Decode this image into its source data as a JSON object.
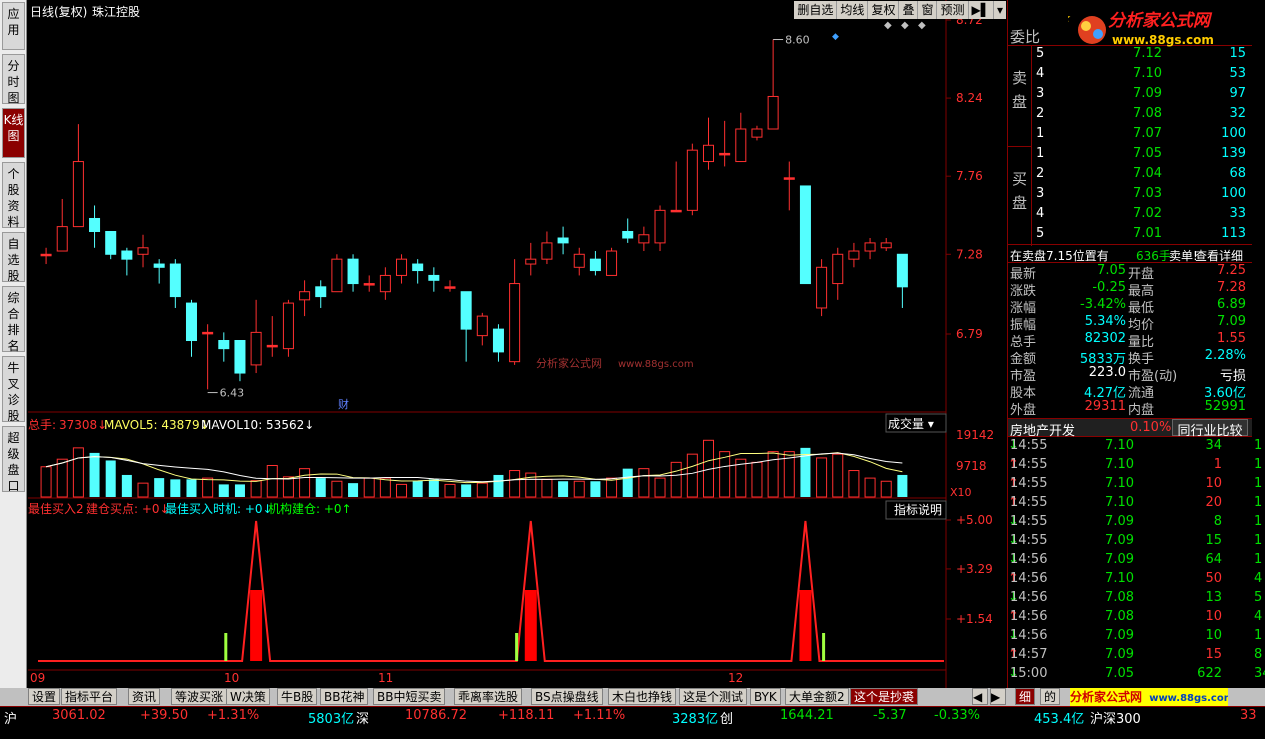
{
  "left_tabs": [
    {
      "label": "应用"
    },
    {
      "label": "分时图"
    },
    {
      "label": "K线图",
      "active": true
    },
    {
      "label": "个股资料"
    },
    {
      "label": "自选股"
    },
    {
      "label": "综合排名"
    },
    {
      "label": "牛叉诊股"
    },
    {
      "label": "超级盘口"
    }
  ],
  "header": {
    "mode": "日线(复权)",
    "stock": "珠江控股",
    "buttons": [
      "删自选",
      "均线",
      "复权",
      "叠",
      "窗",
      "预测"
    ]
  },
  "price_axis": [
    "8.72",
    "8.24",
    "7.76",
    "7.28",
    "6.79"
  ],
  "annotations": {
    "high": "8.60",
    "low": "6.43",
    "cai": "财",
    "watermark1": "分析家公式网",
    "watermark2": "www.88gs.com"
  },
  "volume": {
    "label_total": "总手:",
    "total": "37308",
    "ma5_label": "MAVOL5:",
    "ma5": "43879",
    "ma10_label": "MAVOL10:",
    "ma10": "53562",
    "panel_btn": "成交量",
    "axis": [
      "19142",
      "9718"
    ],
    "unit": "X10"
  },
  "indicator": {
    "l1": "最佳买入2",
    "l2": "建仓买点:",
    "v2": "+0",
    "l3": "最佳买入时机:",
    "v3": "+0",
    "l4": "机构建仓:",
    "v4": "+0",
    "btn": "指标说明",
    "axis": [
      "+5.00",
      "+3.29",
      "+1.54"
    ]
  },
  "dates": [
    "09",
    "10",
    "11",
    "12"
  ],
  "candles": [
    {
      "o": 7.28,
      "c": 7.28,
      "h": 7.32,
      "l": 7.22
    },
    {
      "o": 7.3,
      "c": 7.45,
      "h": 7.62,
      "l": 7.3
    },
    {
      "o": 7.45,
      "c": 7.85,
      "h": 8.08,
      "l": 7.45
    },
    {
      "o": 7.5,
      "c": 7.42,
      "h": 7.58,
      "l": 7.32
    },
    {
      "o": 7.42,
      "c": 7.28,
      "h": 7.42,
      "l": 7.25
    },
    {
      "o": 7.3,
      "c": 7.25,
      "h": 7.32,
      "l": 7.15
    },
    {
      "o": 7.28,
      "c": 7.32,
      "h": 7.4,
      "l": 7.2
    },
    {
      "o": 7.22,
      "c": 7.2,
      "h": 7.25,
      "l": 7.1
    },
    {
      "o": 7.22,
      "c": 7.02,
      "h": 7.25,
      "l": 6.95
    },
    {
      "o": 6.98,
      "c": 6.75,
      "h": 7.0,
      "l": 6.65
    },
    {
      "o": 6.8,
      "c": 6.8,
      "h": 6.85,
      "l": 6.45
    },
    {
      "o": 6.75,
      "c": 6.7,
      "h": 6.8,
      "l": 6.62
    },
    {
      "o": 6.75,
      "c": 6.55,
      "h": 6.75,
      "l": 6.5
    },
    {
      "o": 6.6,
      "c": 6.8,
      "h": 7.0,
      "l": 6.55
    },
    {
      "o": 6.72,
      "c": 6.72,
      "h": 6.9,
      "l": 6.65
    },
    {
      "o": 6.7,
      "c": 6.98,
      "h": 7.0,
      "l": 6.65
    },
    {
      "o": 7.0,
      "c": 7.05,
      "h": 7.12,
      "l": 6.9
    },
    {
      "o": 7.08,
      "c": 7.02,
      "h": 7.12,
      "l": 6.95
    },
    {
      "o": 7.05,
      "c": 7.25,
      "h": 7.28,
      "l": 7.05
    },
    {
      "o": 7.25,
      "c": 7.1,
      "h": 7.28,
      "l": 7.05
    },
    {
      "o": 7.1,
      "c": 7.1,
      "h": 7.15,
      "l": 7.05
    },
    {
      "o": 7.05,
      "c": 7.15,
      "h": 7.2,
      "l": 7.0
    },
    {
      "o": 7.15,
      "c": 7.25,
      "h": 7.28,
      "l": 7.1
    },
    {
      "o": 7.22,
      "c": 7.18,
      "h": 7.25,
      "l": 7.1
    },
    {
      "o": 7.15,
      "c": 7.12,
      "h": 7.2,
      "l": 7.05
    },
    {
      "o": 7.08,
      "c": 7.08,
      "h": 7.12,
      "l": 7.05
    },
    {
      "o": 7.05,
      "c": 6.82,
      "h": 7.05,
      "l": 6.62
    },
    {
      "o": 6.78,
      "c": 6.9,
      "h": 6.92,
      "l": 6.72
    },
    {
      "o": 6.82,
      "c": 6.68,
      "h": 6.85,
      "l": 6.62
    },
    {
      "o": 6.62,
      "c": 7.1,
      "h": 7.25,
      "l": 6.6
    },
    {
      "o": 7.22,
      "c": 7.25,
      "h": 7.35,
      "l": 7.15
    },
    {
      "o": 7.25,
      "c": 7.35,
      "h": 7.42,
      "l": 7.22
    },
    {
      "o": 7.38,
      "c": 7.35,
      "h": 7.45,
      "l": 7.28
    },
    {
      "o": 7.2,
      "c": 7.28,
      "h": 7.32,
      "l": 7.15
    },
    {
      "o": 7.25,
      "c": 7.18,
      "h": 7.3,
      "l": 7.15
    },
    {
      "o": 7.15,
      "c": 7.3,
      "h": 7.32,
      "l": 7.15
    },
    {
      "o": 7.42,
      "c": 7.38,
      "h": 7.5,
      "l": 7.35
    },
    {
      "o": 7.35,
      "c": 7.4,
      "h": 7.45,
      "l": 7.3
    },
    {
      "o": 7.35,
      "c": 7.55,
      "h": 7.58,
      "l": 7.3
    },
    {
      "o": 7.55,
      "c": 7.55,
      "h": 7.85,
      "l": 7.55
    },
    {
      "o": 7.55,
      "c": 7.92,
      "h": 7.96,
      "l": 7.52
    },
    {
      "o": 7.85,
      "c": 7.95,
      "h": 8.12,
      "l": 7.8
    },
    {
      "o": 7.9,
      "c": 7.9,
      "h": 8.1,
      "l": 7.82
    },
    {
      "o": 7.85,
      "c": 8.05,
      "h": 8.15,
      "l": 7.85
    },
    {
      "o": 8.0,
      "c": 8.05,
      "h": 8.07,
      "l": 7.98
    },
    {
      "o": 8.05,
      "c": 8.25,
      "h": 8.6,
      "l": 8.05
    },
    {
      "o": 7.75,
      "c": 7.75,
      "h": 7.85,
      "l": 7.55
    },
    {
      "o": 7.7,
      "c": 7.1,
      "h": 7.7,
      "l": 7.1
    },
    {
      "o": 6.95,
      "c": 7.2,
      "h": 7.25,
      "l": 6.9
    },
    {
      "o": 7.1,
      "c": 7.28,
      "h": 7.32,
      "l": 7.0
    },
    {
      "o": 7.25,
      "c": 7.3,
      "h": 7.35,
      "l": 7.2
    },
    {
      "o": 7.3,
      "c": 7.35,
      "h": 7.38,
      "l": 7.25
    },
    {
      "o": 7.32,
      "c": 7.35,
      "h": 7.38,
      "l": 7.3
    },
    {
      "o": 7.28,
      "c": 7.08,
      "h": 7.28,
      "l": 6.95
    }
  ],
  "volumes": [
    0.48,
    0.6,
    0.78,
    0.7,
    0.58,
    0.35,
    0.22,
    0.3,
    0.28,
    0.28,
    0.3,
    0.2,
    0.2,
    0.26,
    0.5,
    0.32,
    0.45,
    0.3,
    0.25,
    0.22,
    0.3,
    0.3,
    0.2,
    0.26,
    0.28,
    0.2,
    0.2,
    0.22,
    0.35,
    0.42,
    0.38,
    0.28,
    0.25,
    0.25,
    0.25,
    0.3,
    0.45,
    0.45,
    0.3,
    0.55,
    0.68,
    0.9,
    0.72,
    0.6,
    0.55,
    0.72,
    0.72,
    0.78,
    0.62,
    0.68,
    0.42,
    0.3,
    0.25,
    0.35
  ],
  "order_book": {
    "title": "委比",
    "sell_label": "卖盘",
    "buy_label": "买盘",
    "sells": [
      {
        "lv": "5",
        "p": "7.12",
        "q": "15"
      },
      {
        "lv": "4",
        "p": "7.10",
        "q": "53"
      },
      {
        "lv": "3",
        "p": "7.09",
        "q": "97"
      },
      {
        "lv": "2",
        "p": "7.08",
        "q": "32"
      },
      {
        "lv": "1",
        "p": "7.07",
        "q": "100"
      }
    ],
    "buys": [
      {
        "lv": "1",
        "p": "7.05",
        "q": "139"
      },
      {
        "lv": "2",
        "p": "7.04",
        "q": "68"
      },
      {
        "lv": "3",
        "p": "7.03",
        "q": "100"
      },
      {
        "lv": "4",
        "p": "7.02",
        "q": "33"
      },
      {
        "lv": "5",
        "p": "7.01",
        "q": "113"
      }
    ]
  },
  "sell_msg": {
    "a": "在卖盘7.15位置有",
    "b": "636手",
    "c": "卖单!",
    "d": "查看详细"
  },
  "stats": [
    {
      "l1": "最新",
      "v1": "7.05",
      "c1": "grn",
      "l2": "开盘",
      "v2": "7.25",
      "c2": "red"
    },
    {
      "l1": "涨跌",
      "v1": "-0.25",
      "c1": "grn",
      "l2": "最高",
      "v2": "7.28",
      "c2": "red"
    },
    {
      "l1": "涨幅",
      "v1": "-3.42%",
      "c1": "grn",
      "l2": "最低",
      "v2": "6.89",
      "c2": "grn"
    },
    {
      "l1": "振幅",
      "v1": "5.34%",
      "c1": "cyan",
      "l2": "均价",
      "v2": "7.09",
      "c2": "grn"
    },
    {
      "l1": "总手",
      "v1": "82302",
      "c1": "cyan",
      "l2": "量比",
      "v2": "1.55",
      "c2": "red"
    },
    {
      "l1": "金额",
      "v1": "5833万",
      "c1": "cyan",
      "l2": "换手",
      "v2": "2.28%",
      "c2": "cyan"
    },
    {
      "l1": "市盈",
      "v1": "223.0",
      "c1": "wht",
      "l2": "市盈(动)",
      "v2": "亏损",
      "c2": "wht"
    },
    {
      "l1": "股本",
      "v1": "4.27亿",
      "c1": "cyan",
      "l2": "流通",
      "v2": "3.60亿",
      "c2": "cyan"
    },
    {
      "l1": "外盘",
      "v1": "29311",
      "c1": "red",
      "l2": "内盘",
      "v2": "52991",
      "c2": "grn"
    }
  ],
  "sector": {
    "name": "房地产开发",
    "pct": "0.10%",
    "btn": "同行业比较"
  },
  "ticks": [
    {
      "t": "14:55",
      "p": "7.10",
      "v": "34",
      "d": "dn"
    },
    {
      "t": "14:55",
      "p": "7.10",
      "v": "1",
      "d": "up"
    },
    {
      "t": "14:55",
      "p": "7.10",
      "v": "10",
      "d": "up"
    },
    {
      "t": "14:55",
      "p": "7.10",
      "v": "20",
      "d": "up"
    },
    {
      "t": "14:55",
      "p": "7.09",
      "v": "8",
      "d": "dn"
    },
    {
      "t": "14:55",
      "p": "7.09",
      "v": "15",
      "d": "dn"
    },
    {
      "t": "14:56",
      "p": "7.09",
      "v": "64",
      "d": "dn"
    },
    {
      "t": "14:56",
      "p": "7.10",
      "v": "50",
      "d": "up"
    },
    {
      "t": "14:56",
      "p": "7.08",
      "v": "13",
      "d": "dn"
    },
    {
      "t": "14:56",
      "p": "7.08",
      "v": "10",
      "d": "up"
    },
    {
      "t": "14:56",
      "p": "7.09",
      "v": "10",
      "d": "dn"
    },
    {
      "t": "14:57",
      "p": "7.09",
      "v": "15",
      "d": "up"
    },
    {
      "t": "15:00",
      "p": "7.05",
      "v": "622",
      "d": "dn"
    }
  ],
  "tick_right": [
    "1",
    "1",
    "1",
    "1",
    "1",
    "1",
    "1",
    "4",
    "5",
    "4",
    "1",
    "8",
    "34"
  ],
  "bottom_tabs": [
    "设置",
    "指标平台",
    "资讯",
    "等波买涨",
    "W决策",
    "牛B股",
    "BB花神",
    "BB中短买卖",
    "乖离率选股",
    "BS点操盘线",
    "木白也挣钱",
    "这是个测试",
    "BYK",
    "大单金额2",
    "这个是抄裘"
  ],
  "bottom_right": {
    "t1": "细",
    "t2": "的",
    "wm": "分析家公式网",
    "wm_url": "www.88gs.com"
  },
  "status": {
    "sh": "沪",
    "sh_v": "3061.02",
    "sh_c": "+39.50",
    "sh_p": "+1.31%",
    "sh_amt": "5803亿",
    "sz": "深",
    "sz_v": "10786.72",
    "sz_c": "+118.11",
    "sz_p": "+1.11%",
    "sz_amt": "3283亿",
    "cy": "创",
    "cy_v": "1644.21",
    "cy_c": "-5.37",
    "cy_p": "-0.33%",
    "cy_amt": "453.4亿",
    "hs": "沪深300",
    "tail": "33"
  },
  "logo": {
    "text": "分析家公式网",
    "url": "www.88gs.com"
  },
  "colors": {
    "up": "#ff3030",
    "down": "#54ffff",
    "bg": "#000000",
    "grid": "#800000"
  }
}
